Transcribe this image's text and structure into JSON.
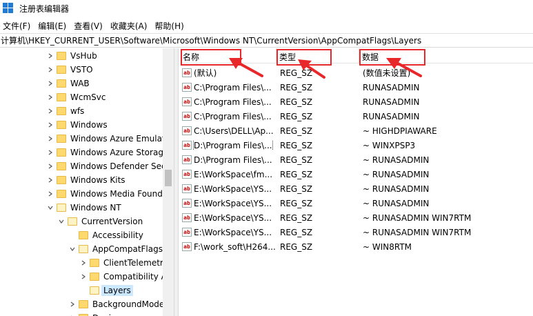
{
  "window": {
    "title": "注册表编辑器"
  },
  "menu": [
    "文件(F)",
    "编辑(E)",
    "查看(V)",
    "收藏夹(A)",
    "帮助(H)"
  ],
  "address": "计算机\\HKEY_CURRENT_USER\\Software\\Microsoft\\Windows NT\\CurrentVersion\\AppCompatFlags\\Layers",
  "tree": [
    {
      "label": "VsHub",
      "expander": "right"
    },
    {
      "label": "VSTO",
      "expander": "right"
    },
    {
      "label": "WAB",
      "expander": "right"
    },
    {
      "label": "WcmSvc",
      "expander": "right"
    },
    {
      "label": "wfs",
      "expander": "right"
    },
    {
      "label": "Windows",
      "expander": "right"
    },
    {
      "label": "Windows Azure Emulat",
      "expander": "right"
    },
    {
      "label": "Windows Azure Storag",
      "expander": "right"
    },
    {
      "label": "Windows Defender Sec",
      "expander": "right"
    },
    {
      "label": "Windows Kits",
      "expander": "right"
    },
    {
      "label": "Windows Media Found",
      "expander": "right"
    },
    {
      "label": "Windows NT",
      "expander": "down"
    },
    {
      "label": "CurrentVersion",
      "expander": "down"
    },
    {
      "label": "Accessibility",
      "expander": "none"
    },
    {
      "label": "AppCompatFlags",
      "expander": "down"
    },
    {
      "label": "ClientTelemetry",
      "expander": "right"
    },
    {
      "label": "Compatibility A",
      "expander": "right"
    },
    {
      "label": "Layers",
      "expander": "none"
    },
    {
      "label": "BackgroundMode",
      "expander": "right"
    },
    {
      "label": "Devices",
      "expander": "right"
    }
  ],
  "list": {
    "headers": {
      "name": "名称",
      "type": "类型",
      "data": "数据"
    },
    "rows": [
      {
        "name": "(默认)",
        "type": "REG_SZ",
        "data": "(数值未设置)"
      },
      {
        "name": "C:\\Program Files\\...",
        "type": "REG_SZ",
        "data": "RUNASADMIN"
      },
      {
        "name": "C:\\Program Files\\...",
        "type": "REG_SZ",
        "data": "RUNASADMIN"
      },
      {
        "name": "C:\\Program Files\\...",
        "type": "REG_SZ",
        "data": "RUNASADMIN"
      },
      {
        "name": "C:\\Users\\DELL\\Ap...",
        "type": "REG_SZ",
        "data": "~ HIGHDPIAWARE"
      },
      {
        "name": "D:\\Program Files\\...",
        "type": "REG_SZ",
        "data": "~ WINXPSP3"
      },
      {
        "name": "D:\\Program Files\\...",
        "type": "REG_SZ",
        "data": "~ RUNASADMIN"
      },
      {
        "name": "E:\\WorkSpace\\fm...",
        "type": "REG_SZ",
        "data": "~ RUNASADMIN"
      },
      {
        "name": "E:\\WorkSpace\\YS...",
        "type": "REG_SZ",
        "data": "~ RUNASADMIN"
      },
      {
        "name": "E:\\WorkSpace\\YS...",
        "type": "REG_SZ",
        "data": "~ RUNASADMIN"
      },
      {
        "name": "E:\\WorkSpace\\YS...",
        "type": "REG_SZ",
        "data": "~ RUNASADMIN WIN7RTM"
      },
      {
        "name": "E:\\WorkSpace\\YS...",
        "type": "REG_SZ",
        "data": "~ RUNASADMIN WIN7RTM"
      },
      {
        "name": "F:\\work_soft\\H264...",
        "type": "REG_SZ",
        "data": "~ WIN8RTM"
      }
    ],
    "value_icon": "ab"
  },
  "colors": {
    "highlight": "#e8272b",
    "selection": "#cce8ff",
    "folder": "#ffd86e"
  }
}
